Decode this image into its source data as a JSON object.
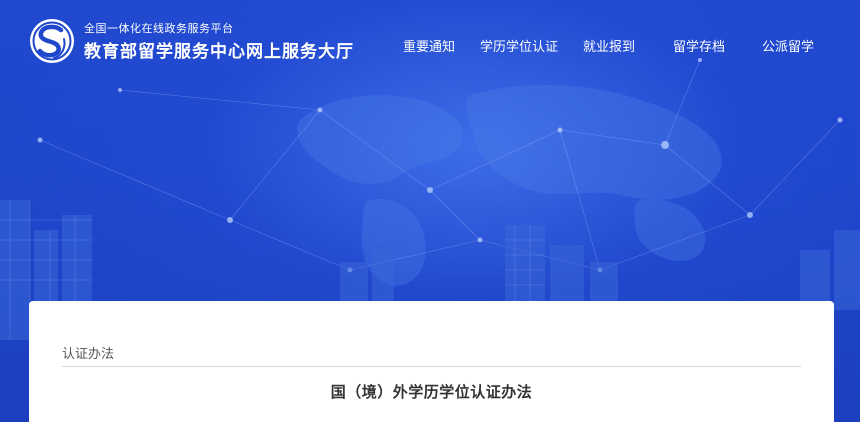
{
  "header": {
    "subtitle": "全国一体化在线政务服务平台",
    "title": "教育部留学服务中心网上服务大厅"
  },
  "nav": {
    "items": [
      {
        "label": "重要通知"
      },
      {
        "label": "学历学位认证"
      },
      {
        "label": "就业报到"
      },
      {
        "label": "留学存档"
      },
      {
        "label": "公派留学"
      }
    ]
  },
  "content": {
    "breadcrumb": "认证办法",
    "doc_title": "国（境）外学历学位认证办法"
  },
  "colors": {
    "hero_blue": "#1f47cc",
    "card_bg": "#ffffff",
    "text_dark": "#333333",
    "text_muted": "#555555"
  }
}
